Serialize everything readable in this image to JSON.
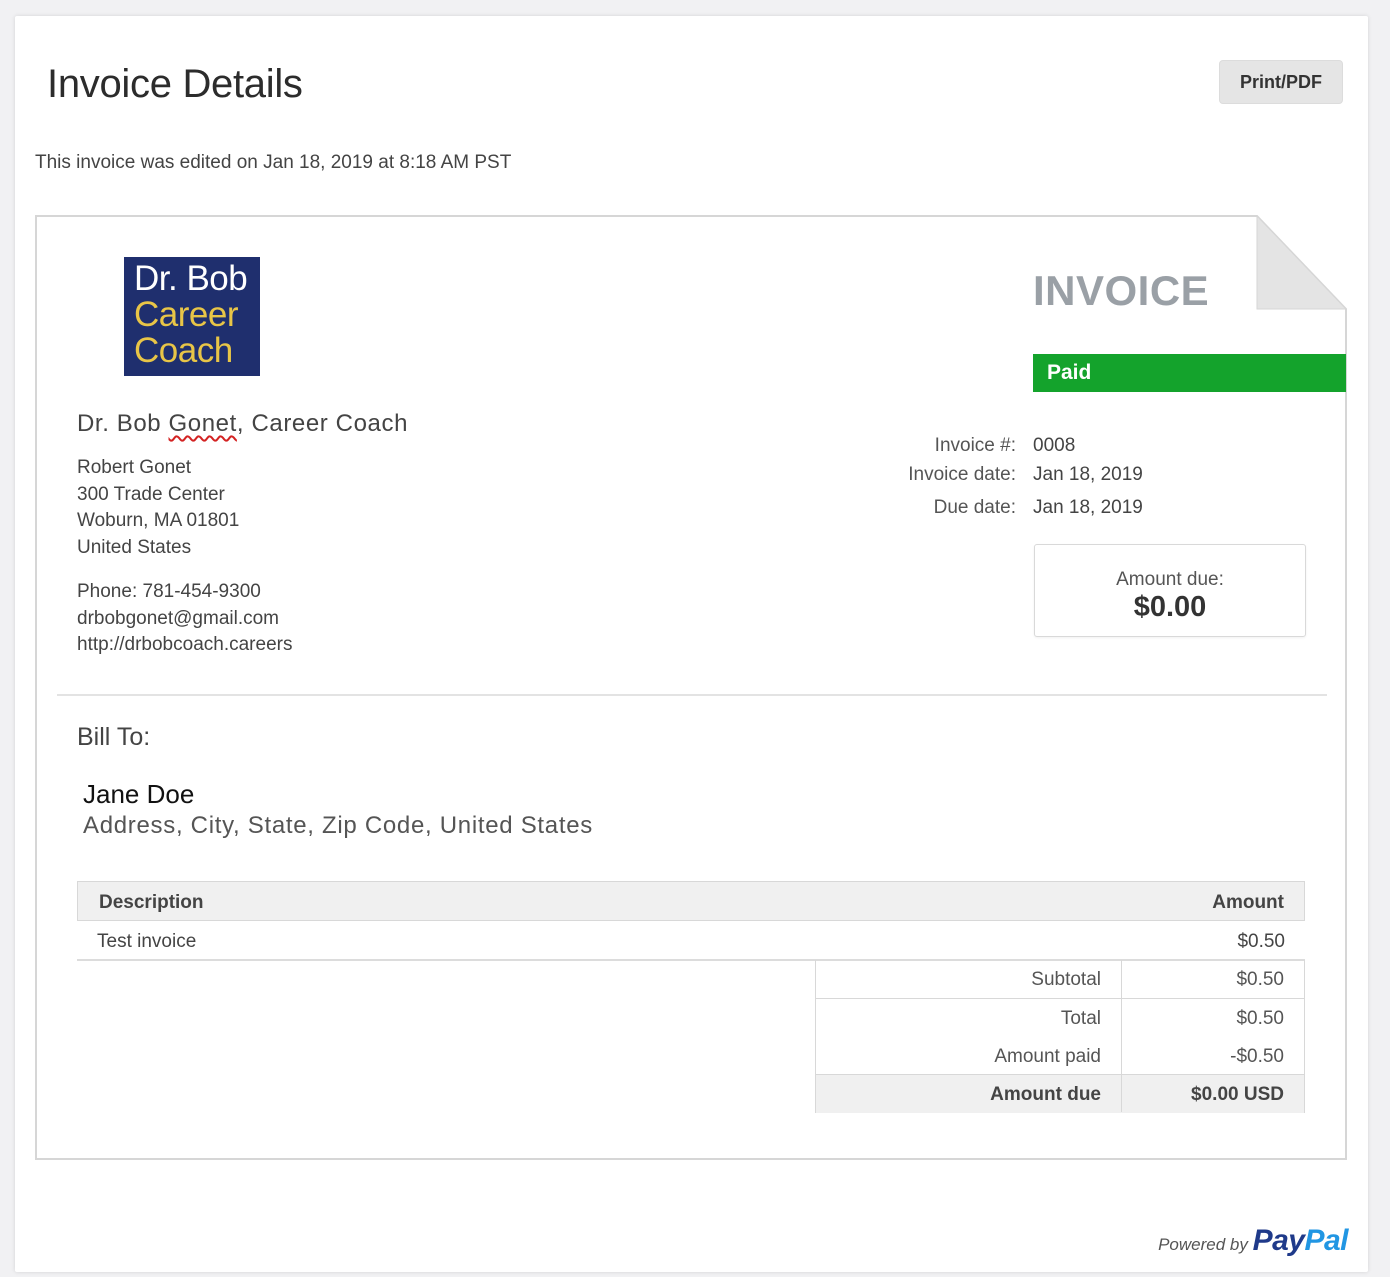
{
  "header": {
    "title": "Invoice Details",
    "print_label": "Print/PDF",
    "edited_note": "This invoice was edited on Jan 18, 2019 at 8:18 AM PST"
  },
  "logo": {
    "line1": "Dr. Bob",
    "line2": "Career",
    "line3": "Coach"
  },
  "invoice": {
    "heading": "INVOICE",
    "status": "Paid",
    "status_color": "#14a32c",
    "meta": [
      {
        "label": "Invoice #:",
        "value": "0008"
      },
      {
        "label": "Invoice date:",
        "value": "Jan 18, 2019"
      },
      {
        "label": "Due date:",
        "value": "Jan 18, 2019"
      }
    ],
    "amount_due_label": "Amount due:",
    "amount_due_value": "$0.00"
  },
  "business": {
    "name_part1": "Dr. Bob ",
    "name_part2": "Gonet",
    "name_part3": ", Career Coach",
    "contact_name": "Robert Gonet",
    "address1": "300 Trade Center",
    "address2": "Woburn, MA 01801",
    "country": "United States",
    "phone": "Phone: 781-454-9300",
    "email": "drbobgonet@gmail.com",
    "website": "http://drbobcoach.careers"
  },
  "bill_to": {
    "label": "Bill To:",
    "name": "Jane Doe",
    "address": "Address, City, State, Zip Code, United States"
  },
  "items": {
    "col_description": "Description",
    "col_amount": "Amount",
    "rows": [
      {
        "description": "Test invoice",
        "amount": "$0.50"
      }
    ]
  },
  "totals": [
    {
      "label": "Subtotal",
      "value": "$0.50"
    },
    {
      "label": "Total",
      "value": "$0.50"
    },
    {
      "label": "Amount paid",
      "value": "-$0.50"
    },
    {
      "label": "Amount due",
      "value": "$0.00 USD"
    }
  ],
  "footer": {
    "powered_by": "Powered by",
    "brand_part1": "Pay",
    "brand_part2": "Pal",
    "brand_color_dark": "#1f3a8a",
    "brand_color_light": "#2196e3"
  }
}
